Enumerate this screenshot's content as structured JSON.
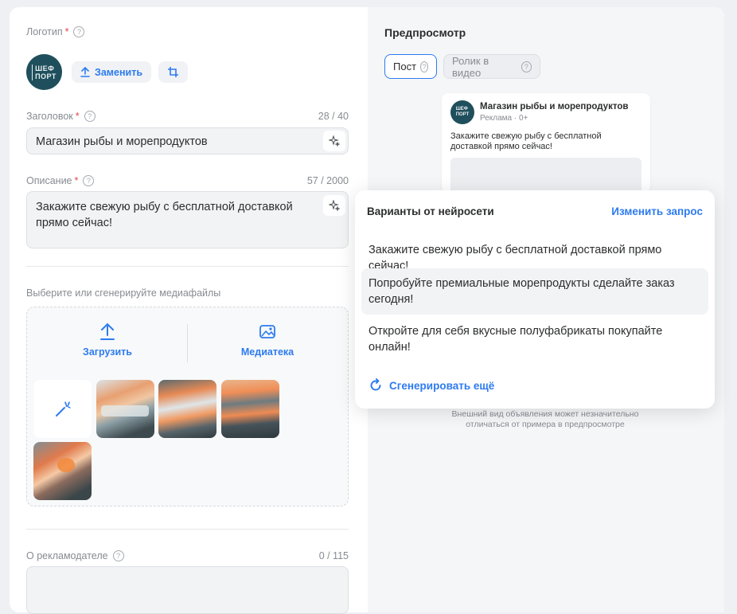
{
  "form": {
    "logo": {
      "label": "Логотип",
      "required_mark": "*",
      "avatar_text": "ШЕФ\nПОРТ",
      "replace_label": "Заменить"
    },
    "title": {
      "label": "Заголовок",
      "required_mark": "*",
      "counter": "28 / 40",
      "value": "Магазин рыбы и морепродуктов"
    },
    "description": {
      "label": "Описание",
      "required_mark": "*",
      "counter": "57 / 2000",
      "value": "Закажите свежую рыбу с бесплатной доставкой прямо сейчас!"
    },
    "media": {
      "label": "Выберите или сгенерируйте медиафайлы",
      "upload_label": "Загрузить",
      "library_label": "Медиатека"
    },
    "advertiser": {
      "label": "О рекламодателе",
      "counter": "0 / 115",
      "value": ""
    }
  },
  "preview": {
    "title": "Предпросмотр",
    "tabs": [
      {
        "label": "Пост"
      },
      {
        "label": "Ролик в видео"
      }
    ],
    "card": {
      "name": "Магазин рыбы и морепродуктов",
      "meta": "Реклама · 0+",
      "text": "Закажите свежую рыбу с бесплатной доставкой прямо сейчас!"
    },
    "disclaimer": "Внешний вид объявления может незначительно отличаться от примера в предпросмотре"
  },
  "ai_popup": {
    "title": "Варианты от нейросети",
    "change_request": "Изменить запрос",
    "options": [
      "Закажите свежую рыбу с бесплатной доставкой прямо сейчас!",
      "Попробуйте премиальные морепродукты сделайте заказ сегодня!",
      "Откройте для себя вкусные полуфабрикаты покупайте онлайн!"
    ],
    "generate_more": "Сгенерировать ещё"
  },
  "colors": {
    "accent": "#2d7bf0",
    "required": "#e64646",
    "field_bg": "#f2f3f5",
    "avatar_bg": "#1f4f5c"
  },
  "icons": [
    "question-icon",
    "upload-arrow-icon",
    "crop-icon",
    "sparkle-icon",
    "gallery-icon",
    "magic-wand-icon",
    "refresh-icon"
  ]
}
